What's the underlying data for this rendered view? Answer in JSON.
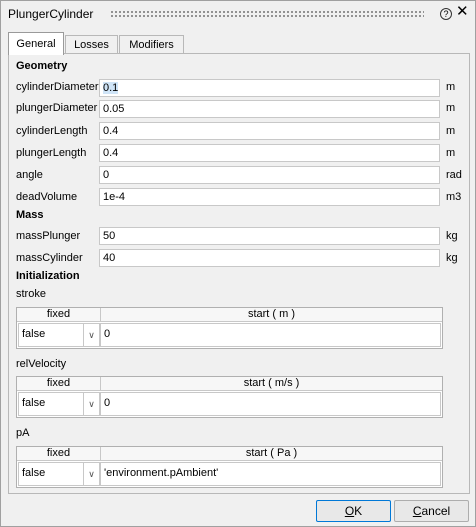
{
  "window": {
    "title": "PlungerCylinder",
    "help_symbol": "?",
    "close_symbol": "✕"
  },
  "tabs": [
    {
      "label": "General",
      "active": true
    },
    {
      "label": "Losses",
      "active": false
    },
    {
      "label": "Modifiers",
      "active": false
    }
  ],
  "geometry": {
    "heading": "Geometry",
    "params": [
      {
        "name": "cylinderDiameter",
        "value": "0.1",
        "unit": "m"
      },
      {
        "name": "plungerDiameter",
        "value": "0.05",
        "unit": "m"
      },
      {
        "name": "cylinderLength",
        "value": "0.4",
        "unit": "m"
      },
      {
        "name": "plungerLength",
        "value": "0.4",
        "unit": "m"
      },
      {
        "name": "angle",
        "value": "0",
        "unit": "rad"
      },
      {
        "name": "deadVolume",
        "value": "1e-4",
        "unit": "m3"
      }
    ]
  },
  "mass": {
    "heading": "Mass",
    "params": [
      {
        "name": "massPlunger",
        "value": "50",
        "unit": "kg"
      },
      {
        "name": "massCylinder",
        "value": "40",
        "unit": "kg"
      }
    ]
  },
  "initialization": {
    "heading": "Initialization",
    "vars": [
      {
        "name": "stroke",
        "fixed_header": "fixed",
        "start_header": "start ( m )",
        "fixed": "false",
        "start": "0"
      },
      {
        "name": "relVelocity",
        "fixed_header": "fixed",
        "start_header": "start ( m/s )",
        "fixed": "false",
        "start": "0"
      },
      {
        "name": "pA",
        "fixed_header": "fixed",
        "start_header": "start ( Pa )",
        "fixed": "false",
        "start": "'environment.pAmbient'"
      }
    ]
  },
  "buttons": {
    "ok": {
      "pre": "",
      "hot": "O",
      "post": "K"
    },
    "cancel": {
      "pre": "",
      "hot": "C",
      "post": "ancel"
    }
  }
}
